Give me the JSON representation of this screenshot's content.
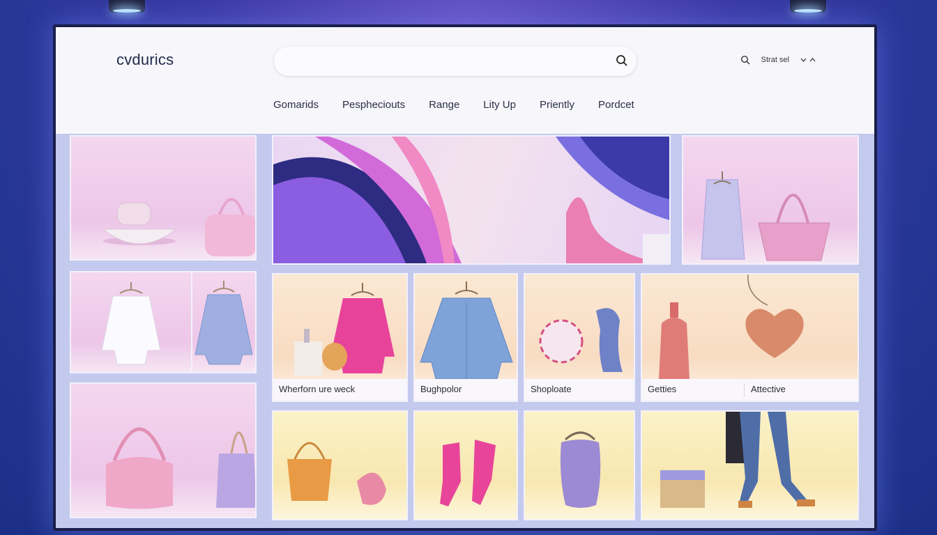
{
  "app": {
    "brand": "cvdurics"
  },
  "search": {
    "placeholder": "",
    "value": ""
  },
  "header_right": {
    "label": "Strat sel"
  },
  "nav": [
    {
      "label": "Gomarids"
    },
    {
      "label": "Pesphecіouts"
    },
    {
      "label": "Range"
    },
    {
      "label": "Lity Up"
    },
    {
      "label": "Priently"
    },
    {
      "label": "Pordcet"
    }
  ],
  "products": [
    {
      "caption": "Wherforn ure weck"
    },
    {
      "caption": "Bughpolor"
    },
    {
      "caption": "Shoploate"
    },
    {
      "caption": "Getties",
      "caption2": "Attective"
    }
  ],
  "colors": {
    "accent": "#e8459a",
    "background": "#2b3aa0",
    "header": "#f7f7fb"
  },
  "icons": [
    "search-icon",
    "chevron-down-icon",
    "chevron-up-icon"
  ]
}
